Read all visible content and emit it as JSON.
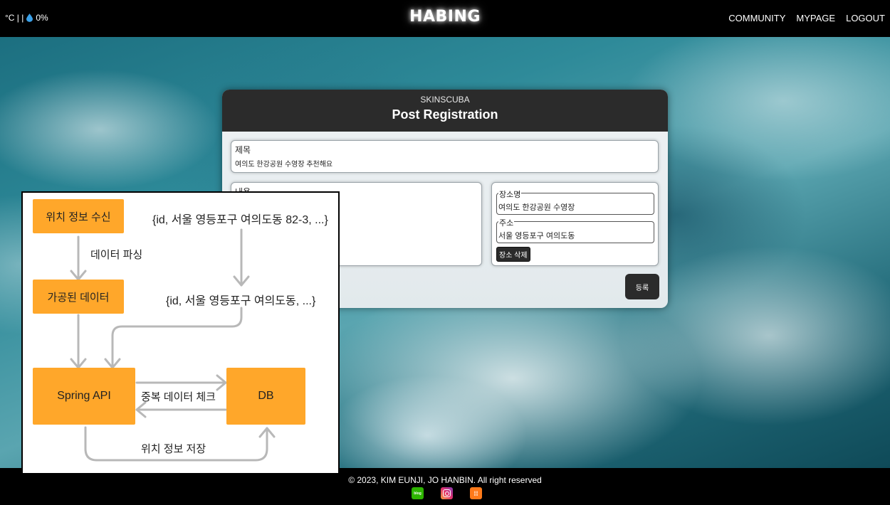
{
  "header": {
    "weather": {
      "temp_text": "°C | |",
      "icon": "water-drop-icon",
      "humidity": "0%"
    },
    "logo": "HABING",
    "nav": [
      "COMMUNITY",
      "MYPAGE",
      "LOGOUT"
    ]
  },
  "card": {
    "brand": "SKINSCUBA",
    "title": "Post Registration",
    "title_field": {
      "label": "제목",
      "value": "여의도 한강공원 수영장 추천해요"
    },
    "content_field": {
      "label": "내용"
    },
    "place": {
      "name_label": "장소명",
      "name_value": "여의도 한강공원 수영장",
      "address_label": "주소",
      "address_value": "서울 영등포구 여의도동",
      "delete_label": "장소 삭제"
    },
    "submit_label": "등록"
  },
  "footer": {
    "copyright": "© 2023, KIM EUNJI, JO HANBIN. All right reserved",
    "social_icons": [
      "blog-icon",
      "instagram-icon",
      "other-app-icon"
    ],
    "blog_text": "blog"
  },
  "diagram": {
    "box_receive": "위치 정보 수신",
    "box_processed": "가공된 데이터",
    "box_api": "Spring API",
    "box_db": "DB",
    "label_raw": "{id, 서울 영등포구 여의도동 82-3, ...}",
    "label_parse": "데이터 파싱",
    "label_processed": "{id, 서울 영등포구 여의도동, ...}",
    "label_dup": "중복 데이터 체크",
    "label_save": "위치 정보 저장",
    "box_color": "#ffa72a",
    "arrow_color": "#b8b8b8"
  }
}
